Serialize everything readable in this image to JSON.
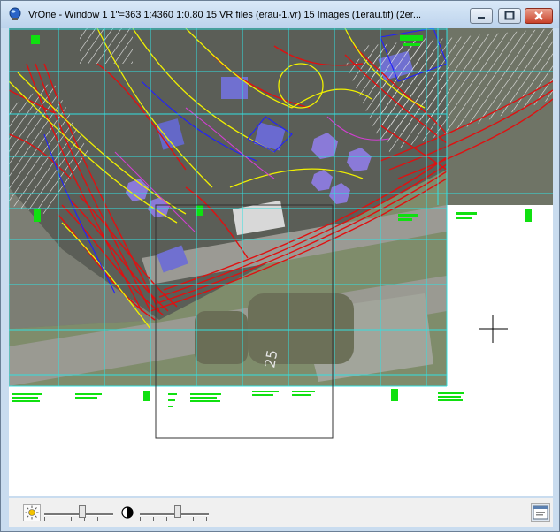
{
  "window": {
    "title": "VrOne - Window 1  1\"=363   1:4360   1:0.80   15 VR files (erau-1.vr)  15 Images (1erau.tif) (2er..."
  },
  "title_buttons": {
    "minimize": "minimize-icon",
    "maximize": "maximize-icon",
    "close": "close-icon"
  },
  "statusbar": {
    "brightness_icon": "sun-icon",
    "contrast_icon": "contrast-icon",
    "brightness_level": 0.55,
    "contrast_level": 0.55,
    "settings_icon": "window-settings-icon"
  },
  "colors": {
    "grid": "#33e0e0",
    "vector_red": "#e01010",
    "vector_yellow": "#f0f000",
    "vector_green": "#10e010",
    "vector_blue": "#2020ff",
    "vector_magenta": "#d040d0",
    "cursor": "#000000"
  }
}
